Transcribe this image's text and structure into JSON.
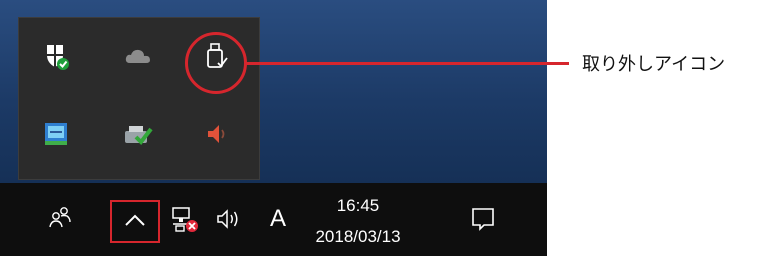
{
  "taskbar": {
    "clock_time": "16:45",
    "clock_date": "2018/03/13",
    "ime_indicator": "A"
  },
  "tray_popup": {
    "icons": [
      "windows-defender-icon",
      "onedrive-icon",
      "safely-remove-hardware-icon",
      "intel-graphics-icon",
      "printer-check-icon",
      "speaker-icon"
    ]
  },
  "callout": {
    "label": "取り外しアイコン",
    "color": "#d6262d"
  }
}
